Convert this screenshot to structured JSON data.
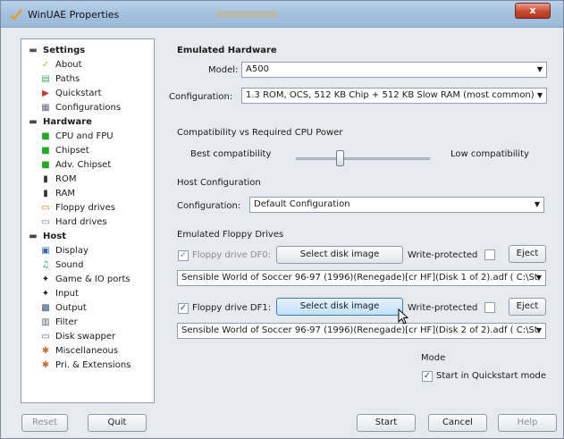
{
  "window": {
    "title": "WinUAE Properties",
    "close_label": "x"
  },
  "tree": {
    "items": [
      {
        "label": "Settings",
        "icon": "settings-icon",
        "bold": true
      },
      {
        "label": "About",
        "icon": "checkmark-icon"
      },
      {
        "label": "Paths",
        "icon": "paths-icon"
      },
      {
        "label": "Quickstart",
        "icon": "quickstart-icon"
      },
      {
        "label": "Configurations",
        "icon": "configurations-icon"
      },
      {
        "label": "Hardware",
        "icon": "hardware-icon",
        "bold": true
      },
      {
        "label": "CPU and FPU",
        "icon": "chip-icon"
      },
      {
        "label": "Chipset",
        "icon": "chip-icon"
      },
      {
        "label": "Adv. Chipset",
        "icon": "chip-icon"
      },
      {
        "label": "ROM",
        "icon": "rom-icon"
      },
      {
        "label": "RAM",
        "icon": "ram-icon"
      },
      {
        "label": "Floppy drives",
        "icon": "floppy-icon"
      },
      {
        "label": "Hard drives",
        "icon": "harddrive-icon"
      },
      {
        "label": "Host",
        "icon": "host-icon",
        "bold": true
      },
      {
        "label": "Display",
        "icon": "display-icon"
      },
      {
        "label": "Sound",
        "icon": "sound-icon"
      },
      {
        "label": "Game & IO ports",
        "icon": "joystick-icon"
      },
      {
        "label": "Input",
        "icon": "joystick-icon"
      },
      {
        "label": "Output",
        "icon": "output-icon"
      },
      {
        "label": "Filter",
        "icon": "filter-icon"
      },
      {
        "label": "Disk swapper",
        "icon": "disk-swapper-icon"
      },
      {
        "label": "Miscellaneous",
        "icon": "misc-icon"
      },
      {
        "label": "Pri. & Extensions",
        "icon": "extensions-icon"
      }
    ]
  },
  "emulated_hardware": {
    "heading": "Emulated Hardware",
    "model_label": "Model:",
    "model_value": "A500",
    "configuration_label": "Configuration:",
    "configuration_value": "1.3 ROM, OCS, 512 KB Chip + 512 KB Slow RAM (most common)"
  },
  "compatibility": {
    "heading": "Compatibility vs Required CPU Power",
    "left_label": "Best compatibility",
    "right_label": "Low compatibility"
  },
  "host_configuration": {
    "heading": "Host Configuration",
    "configuration_label": "Configuration:",
    "configuration_value": "Default Configuration"
  },
  "floppy": {
    "heading": "Emulated Floppy Drives",
    "df0_label": "Floppy drive DF0:",
    "df0_enabled": false,
    "df0_select": "Select disk image",
    "df0_write_protected": "Write-protected",
    "df0_eject": "Eject",
    "df0_path": "Sensible World of Soccer 96-97 (1996)(Renegade)[cr HF](Disk 1 of 2).adf ( C:\\St",
    "df1_label": "Floppy drive DF1:",
    "df1_enabled": true,
    "df1_select": "Select disk image",
    "df1_write_protected": "Write-protected",
    "df1_eject": "Eject",
    "df1_path": "Sensible World of Soccer 96-97 (1996)(Renegade)[cr HF](Disk 2 of 2).adf ( C:\\St"
  },
  "mode": {
    "heading": "Mode",
    "quickstart_label": "Start in Quickstart mode",
    "quickstart_checked": true
  },
  "footer": {
    "reset": "Reset",
    "quit": "Quit",
    "start": "Start",
    "cancel": "Cancel",
    "help": "Help"
  },
  "colors": {
    "accent": "#3c7fb1",
    "title_bar": "#a6c1de",
    "close": "#c8492f"
  }
}
